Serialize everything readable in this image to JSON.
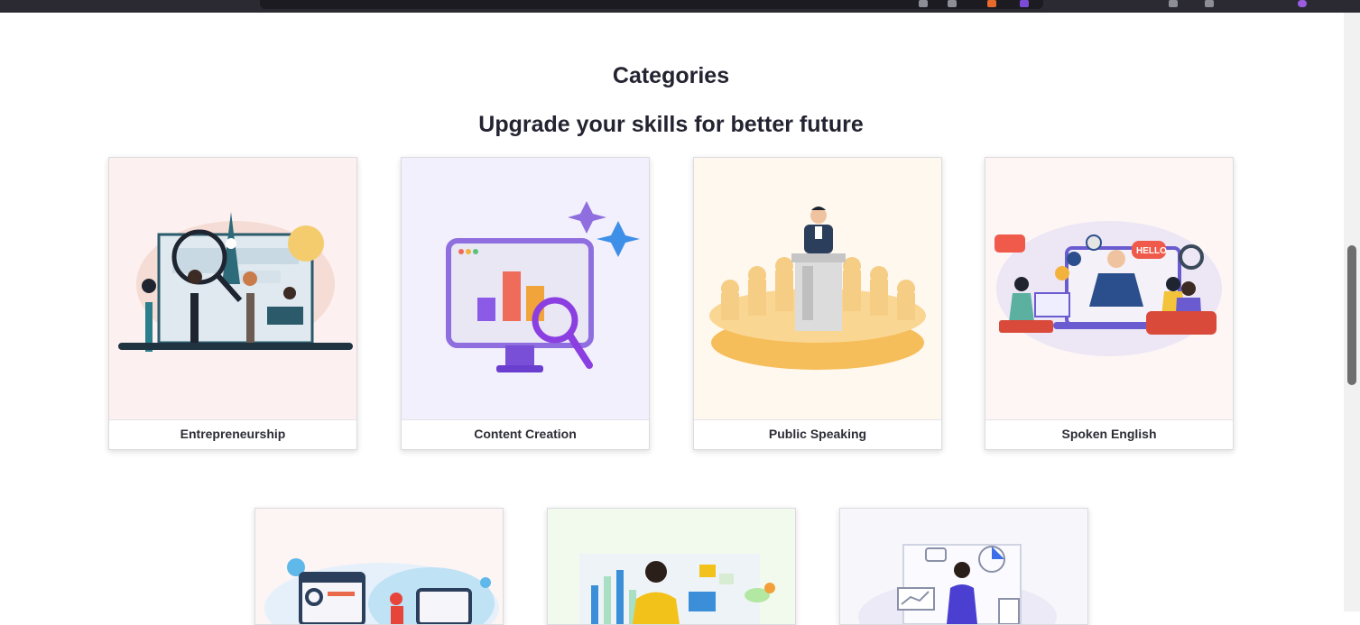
{
  "section": {
    "title": "Categories",
    "subtitle": "Upgrade your skills for better future"
  },
  "categories": [
    {
      "label": "Entrepreneurship",
      "icon": "entrepreneurship-illustration"
    },
    {
      "label": "Content Creation",
      "icon": "content-creation-illustration"
    },
    {
      "label": "Public Speaking",
      "icon": "public-speaking-illustration"
    },
    {
      "label": "Spoken English",
      "icon": "spoken-english-illustration",
      "bubble_text": "HELLO"
    }
  ],
  "colors": {
    "card_bg_entrepreneurship": "#fcf0f0",
    "card_bg_content": "#f3f0fd",
    "card_bg_speaking": "#fff8ef",
    "card_bg_english": "#fdf6f5",
    "heading": "#232331"
  }
}
